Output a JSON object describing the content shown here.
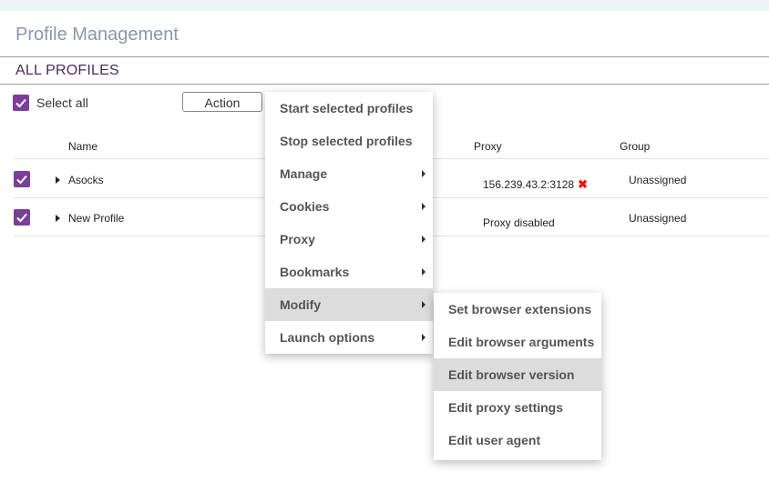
{
  "header": {
    "title": "Profile Management"
  },
  "section": {
    "title": "ALL PROFILES"
  },
  "toolbar": {
    "select_all_label": "Select all",
    "action_label": "Action"
  },
  "table": {
    "columns": {
      "name": "Name",
      "proxy": "Proxy",
      "group": "Group"
    },
    "rows": [
      {
        "name": "Asocks",
        "proxy": "156.239.43.2:3128",
        "proxy_error": "✖",
        "group": "Unassigned",
        "checked": true
      },
      {
        "name": "New Profile",
        "proxy": "Proxy disabled",
        "group": "Unassigned",
        "checked": true
      }
    ]
  },
  "action_menu": {
    "items": [
      {
        "label": "Start selected profiles",
        "submenu": false
      },
      {
        "label": "Stop selected profiles",
        "submenu": false
      },
      {
        "label": "Manage",
        "submenu": true
      },
      {
        "label": "Cookies",
        "submenu": true
      },
      {
        "label": "Proxy",
        "submenu": true
      },
      {
        "label": "Bookmarks",
        "submenu": true
      },
      {
        "label": "Modify",
        "submenu": true,
        "highlighted": true
      },
      {
        "label": "Launch options",
        "submenu": true
      }
    ]
  },
  "modify_submenu": {
    "items": [
      {
        "label": "Set browser extensions"
      },
      {
        "label": "Edit browser arguments"
      },
      {
        "label": "Edit browser version",
        "highlighted": true
      },
      {
        "label": "Edit proxy settings"
      },
      {
        "label": "Edit user agent"
      }
    ]
  },
  "colors": {
    "accent": "#7b3f98",
    "error": "#e11111",
    "highlight": "#dcdcdc"
  }
}
